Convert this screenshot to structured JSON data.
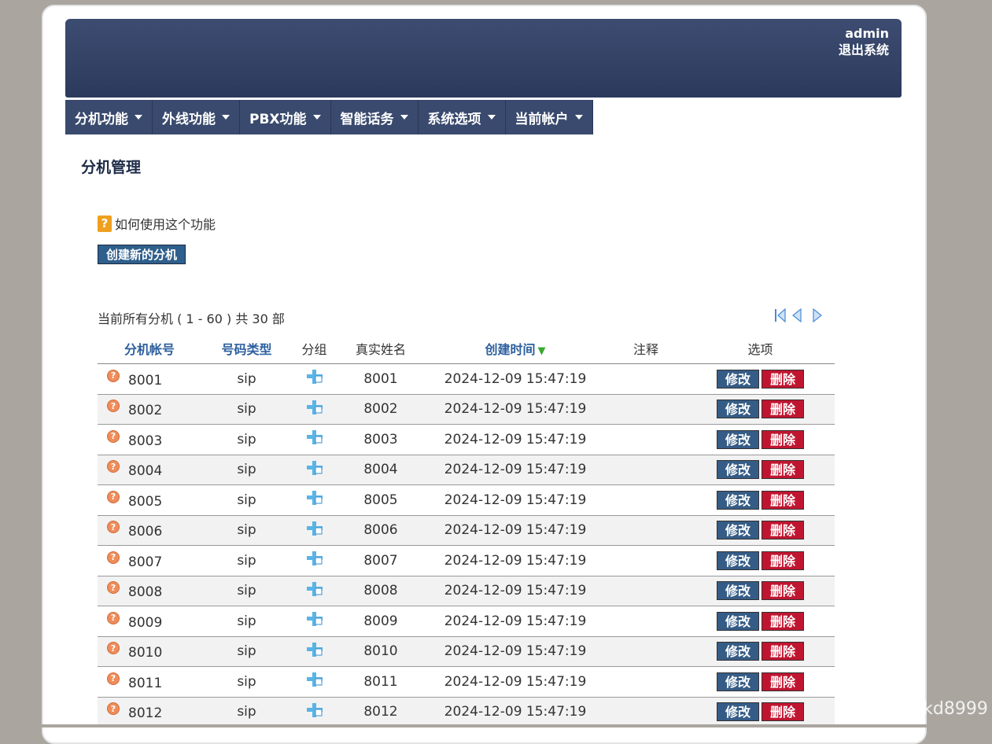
{
  "header": {
    "username": "admin",
    "logout": "退出系统"
  },
  "nav": [
    {
      "label": "分机功能"
    },
    {
      "label": "外线功能"
    },
    {
      "label": "PBX功能"
    },
    {
      "label": "智能话务"
    },
    {
      "label": "系统选项"
    },
    {
      "label": "当前帐户"
    }
  ],
  "page": {
    "title": "分机管理",
    "help_text": "如何使用这个功能",
    "create_button": "创建新的分机",
    "summary": "当前所有分机 ( 1 - 60 ) 共 30 部"
  },
  "table": {
    "headers": {
      "account": "分机帐号",
      "type": "号码类型",
      "group": "分组",
      "name": "真实姓名",
      "created": "创建时间",
      "note": "注释",
      "options": "选项"
    },
    "edit_label": "修改",
    "delete_label": "删除",
    "rows": [
      {
        "account": "8001",
        "type": "sip",
        "name": "8001",
        "created": "2024-12-09 15:47:19",
        "note": ""
      },
      {
        "account": "8002",
        "type": "sip",
        "name": "8002",
        "created": "2024-12-09 15:47:19",
        "note": ""
      },
      {
        "account": "8003",
        "type": "sip",
        "name": "8003",
        "created": "2024-12-09 15:47:19",
        "note": ""
      },
      {
        "account": "8004",
        "type": "sip",
        "name": "8004",
        "created": "2024-12-09 15:47:19",
        "note": ""
      },
      {
        "account": "8005",
        "type": "sip",
        "name": "8005",
        "created": "2024-12-09 15:47:19",
        "note": ""
      },
      {
        "account": "8006",
        "type": "sip",
        "name": "8006",
        "created": "2024-12-09 15:47:19",
        "note": ""
      },
      {
        "account": "8007",
        "type": "sip",
        "name": "8007",
        "created": "2024-12-09 15:47:19",
        "note": ""
      },
      {
        "account": "8008",
        "type": "sip",
        "name": "8008",
        "created": "2024-12-09 15:47:19",
        "note": ""
      },
      {
        "account": "8009",
        "type": "sip",
        "name": "8009",
        "created": "2024-12-09 15:47:19",
        "note": ""
      },
      {
        "account": "8010",
        "type": "sip",
        "name": "8010",
        "created": "2024-12-09 15:47:19",
        "note": ""
      },
      {
        "account": "8011",
        "type": "sip",
        "name": "8011",
        "created": "2024-12-09 15:47:19",
        "note": ""
      },
      {
        "account": "8012",
        "type": "sip",
        "name": "8012",
        "created": "2024-12-09 15:47:19",
        "note": ""
      }
    ]
  },
  "watermark": "CSDN @skd8999",
  "colors": {
    "banner": "#3a4a6e",
    "accent_blue": "#2c5f9e",
    "edit": "#355c86",
    "delete": "#c01530"
  }
}
